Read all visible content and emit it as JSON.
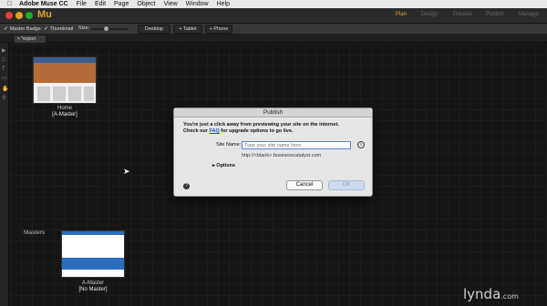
{
  "menubar": {
    "items": [
      "Adobe Muse CC",
      "File",
      "Edit",
      "Page",
      "Object",
      "View",
      "Window",
      "Help"
    ]
  },
  "titlebar": {
    "app_logo": "Mu",
    "modes": [
      "Plan",
      "Design",
      "Preview",
      "Publish",
      "Manage"
    ],
    "active_mode": "Plan",
    "accent_color": "#e69a3c"
  },
  "toolbar": {
    "master_badge": "Master Badge",
    "thumbnail": "Thumbnail",
    "size_label": "Size:",
    "desktop": "Desktop",
    "tablet": "+ Tablet",
    "phone": "+ Phone"
  },
  "subbar": {
    "tab": "*export"
  },
  "pages": {
    "home_name": "Home",
    "home_master": "[A-Master]",
    "masters_label": "Masters",
    "amaster_name": "A-Master",
    "amaster_master": "[No Master]"
  },
  "dialog": {
    "title": "Publish",
    "message_line1": "You're just a click away from previewing your site on the internet.",
    "message_pre": "Check our ",
    "message_link": "FAQ",
    "message_post": " for upgrade options to go live.",
    "site_name_label": "Site Name:",
    "site_name_placeholder": "Type your site name here",
    "url_hint": "http://<blank>.businesscatalyst.com",
    "options_label": "Options",
    "cancel_label": "Cancel",
    "ok_label": "OK"
  },
  "watermark": {
    "text": "lynda",
    "suffix": ".com"
  }
}
